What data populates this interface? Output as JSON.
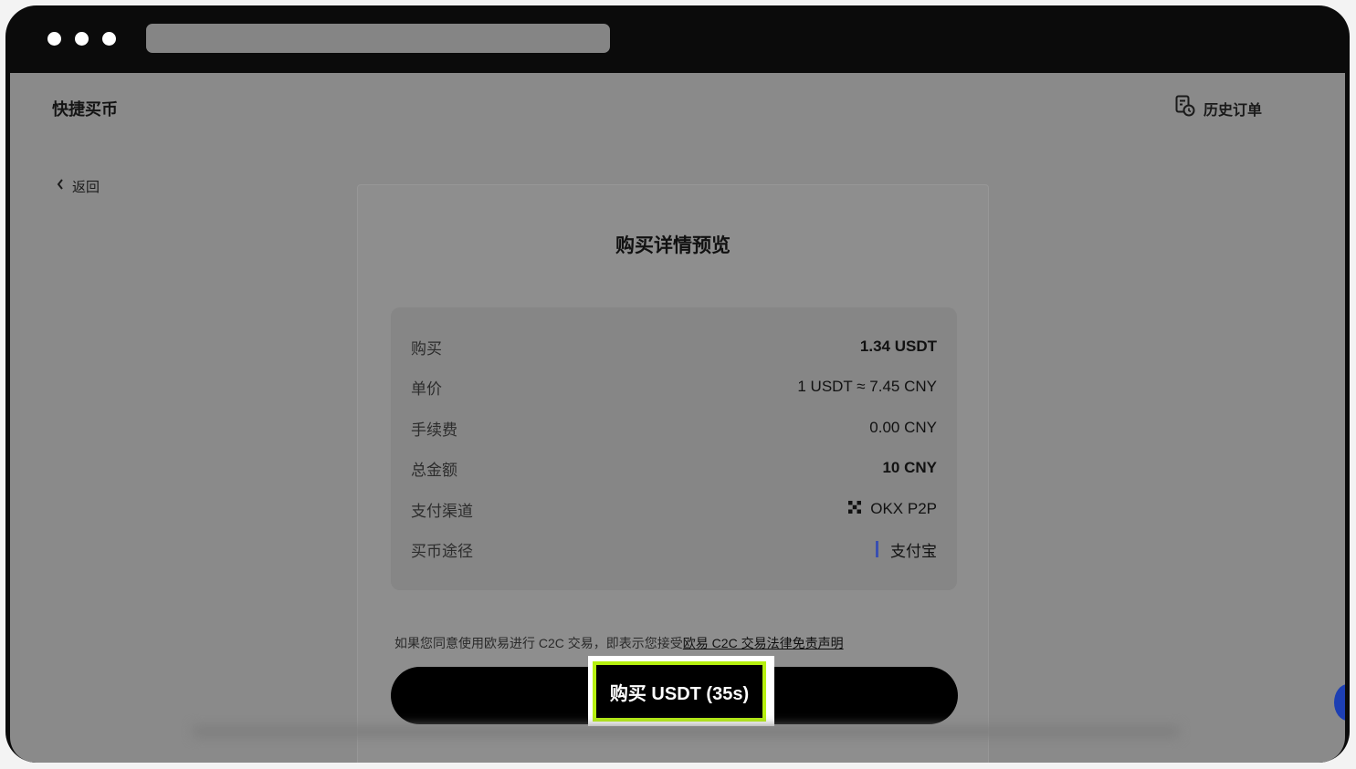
{
  "header": {
    "app_title": "快捷买币",
    "history_label": "历史订单"
  },
  "nav": {
    "back_label": "返回"
  },
  "card": {
    "title": "购买详情预览",
    "rows": [
      {
        "label": "购买",
        "value": "1.34 USDT"
      },
      {
        "label": "单价",
        "value": "1 USDT ≈ 7.45 CNY"
      },
      {
        "label": "手续费",
        "value": "0.00 CNY"
      },
      {
        "label": "总金额",
        "value": "10 CNY"
      },
      {
        "label": "支付渠道",
        "value": "OKX P2P"
      },
      {
        "label": "买币途径",
        "value": "支付宝"
      }
    ],
    "disclaimer_text": "如果您同意使用欧易进行 C2C 交易，即表示您接受",
    "disclaimer_link": "欧易 C2C 交易法律免责声明",
    "buy_button_label": "购买 USDT (35s)"
  },
  "colors": {
    "highlight_border": "#b6f00f",
    "button_bg": "#000000",
    "alipay_accent": "#3a4fb0"
  },
  "icons": {
    "history": "receipt-clock-icon",
    "back": "chevron-left-icon",
    "payment_channel": "okx-logo-icon"
  }
}
